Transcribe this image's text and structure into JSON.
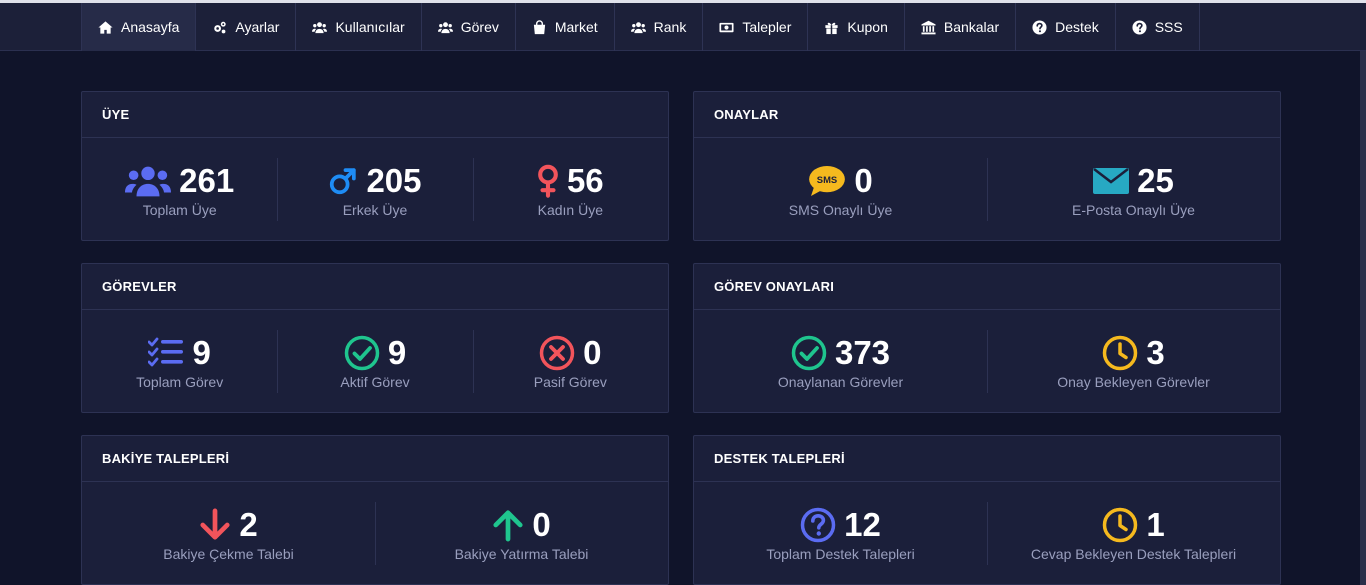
{
  "nav": [
    {
      "label": "Anasayfa",
      "icon": "home-icon",
      "active": true
    },
    {
      "label": "Ayarlar",
      "icon": "gears-icon"
    },
    {
      "label": "Kullanıcılar",
      "icon": "users-icon"
    },
    {
      "label": "Görev",
      "icon": "users-icon"
    },
    {
      "label": "Market",
      "icon": "shopping-bag-icon"
    },
    {
      "label": "Rank",
      "icon": "users-icon"
    },
    {
      "label": "Talepler",
      "icon": "money-bill-icon"
    },
    {
      "label": "Kupon",
      "icon": "gift-icon"
    },
    {
      "label": "Bankalar",
      "icon": "bank-icon"
    },
    {
      "label": "Destek",
      "icon": "question-circle-icon"
    },
    {
      "label": "SSS",
      "icon": "question-circle-icon"
    }
  ],
  "colors": {
    "background": "#10142a",
    "card": "#1b1f3a",
    "blue": "#5b6cf2",
    "sky": "#1e8cf5",
    "red": "#f2545b",
    "green": "#1fc58e",
    "yellow": "#f5b91e",
    "teal": "#27a9c3"
  },
  "cards": {
    "uye": {
      "title": "ÜYE",
      "stats": [
        {
          "value": "261",
          "label": "Toplam Üye",
          "icon": "users-icon"
        },
        {
          "value": "205",
          "label": "Erkek Üye",
          "icon": "mars-icon"
        },
        {
          "value": "56",
          "label": "Kadın Üye",
          "icon": "venus-icon"
        }
      ]
    },
    "onaylar": {
      "title": "ONAYLAR",
      "stats": [
        {
          "value": "0",
          "label": "SMS Onaylı Üye",
          "icon": "sms-icon",
          "icon_text": "SMS"
        },
        {
          "value": "25",
          "label": "E-Posta Onaylı Üye",
          "icon": "envelope-icon"
        }
      ]
    },
    "gorevler": {
      "title": "GÖREVLER",
      "stats": [
        {
          "value": "9",
          "label": "Toplam Görev",
          "icon": "tasks-icon"
        },
        {
          "value": "9",
          "label": "Aktif Görev",
          "icon": "check-circle-icon"
        },
        {
          "value": "0",
          "label": "Pasif Görev",
          "icon": "times-circle-icon"
        }
      ]
    },
    "gorev_onaylari": {
      "title": "GÖREV ONAYLARI",
      "stats": [
        {
          "value": "373",
          "label": "Onaylanan Görevler",
          "icon": "check-circle-icon"
        },
        {
          "value": "3",
          "label": "Onay Bekleyen Görevler",
          "icon": "clock-icon"
        }
      ]
    },
    "bakiye": {
      "title": "BAKİYE TALEPLERİ",
      "stats": [
        {
          "value": "2",
          "label": "Bakiye Çekme Talebi",
          "icon": "arrow-down-icon"
        },
        {
          "value": "0",
          "label": "Bakiye Yatırma Talebi",
          "icon": "arrow-up-icon"
        }
      ]
    },
    "destek": {
      "title": "DESTEK TALEPLERİ",
      "stats": [
        {
          "value": "12",
          "label": "Toplam Destek Talepleri",
          "icon": "question-circle-icon"
        },
        {
          "value": "1",
          "label": "Cevap Bekleyen Destek Talepleri",
          "icon": "clock-icon"
        }
      ]
    }
  }
}
